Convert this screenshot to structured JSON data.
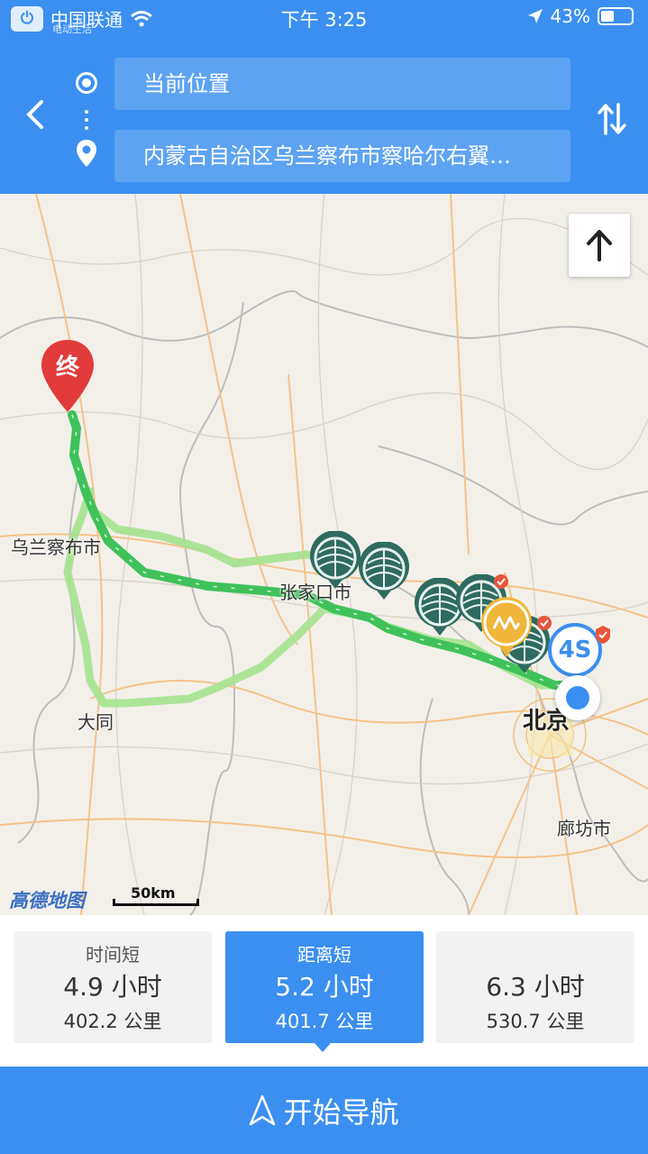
{
  "status_bar": {
    "carrier": "中国联通",
    "watermark": "电动生活",
    "time": "下午 3:25",
    "battery": "43%",
    "battery_level": 0.43
  },
  "header": {
    "origin": "当前位置",
    "destination": "内蒙古自治区乌兰察布市察哈尔右翼…"
  },
  "map": {
    "city_labels": [
      "乌兰察布市",
      "张家口市",
      "大同",
      "北京",
      "廊坊市"
    ],
    "end_marker": "终",
    "poi_4s": "4S",
    "brand": "高德地图",
    "scale": "50km",
    "colors": {
      "selected_route": "#3fc25a",
      "alt_route": "#9be28a",
      "accent": "#3b8ff0",
      "end_marker": "#e23b3b",
      "charging_poi": "#2f6b60",
      "service_poi": "#f0b63a"
    }
  },
  "routes": [
    {
      "tag": "时间短",
      "time": "4.9 小时",
      "distance": "402.2 公里"
    },
    {
      "tag": "距离短",
      "time": "5.2 小时",
      "distance": "401.7 公里"
    },
    {
      "tag": "",
      "time": "6.3 小时",
      "distance": "530.7 公里"
    }
  ],
  "start_navigation": "开始导航"
}
